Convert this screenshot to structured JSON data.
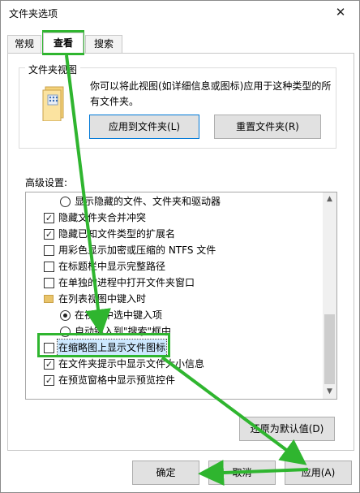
{
  "window": {
    "title": "文件夹选项",
    "close_glyph": "✕"
  },
  "tabs": [
    {
      "label": "常规"
    },
    {
      "label": "查看"
    },
    {
      "label": "搜索"
    }
  ],
  "folder_views": {
    "group_title": "文件夹视图",
    "description": "你可以将此视图(如详细信息或图标)应用于这种类型的所有文件夹。",
    "apply_button": "应用到文件夹(L)",
    "reset_button": "重置文件夹(R)"
  },
  "advanced": {
    "label": "高级设置:",
    "items": [
      {
        "kind": "radio",
        "checked": false,
        "indent": 1,
        "label": "显示隐藏的文件、文件夹和驱动器"
      },
      {
        "kind": "checkbox",
        "checked": true,
        "indent": 0,
        "label": "隐藏文件夹合并冲突"
      },
      {
        "kind": "checkbox",
        "checked": true,
        "indent": 0,
        "label": "隐藏已知文件类型的扩展名"
      },
      {
        "kind": "checkbox",
        "checked": false,
        "indent": 0,
        "label": "用彩色显示加密或压缩的 NTFS 文件"
      },
      {
        "kind": "checkbox",
        "checked": false,
        "indent": 0,
        "label": "在标题栏中显示完整路径"
      },
      {
        "kind": "checkbox",
        "checked": false,
        "indent": 0,
        "label": "在单独的进程中打开文件夹窗口"
      },
      {
        "kind": "folder",
        "checked": false,
        "indent": 0,
        "label": "在列表视图中键入时"
      },
      {
        "kind": "radio",
        "checked": true,
        "indent": 1,
        "label": "在视图中选中键入项"
      },
      {
        "kind": "radio",
        "checked": false,
        "indent": 1,
        "label": "自动键入到\"搜索\"框中"
      },
      {
        "kind": "checkbox",
        "checked": false,
        "indent": 0,
        "label": "在缩略图上显示文件图标",
        "selected": true
      },
      {
        "kind": "checkbox",
        "checked": true,
        "indent": 0,
        "label": "在文件夹提示中显示文件大小信息"
      },
      {
        "kind": "checkbox",
        "checked": true,
        "indent": 0,
        "label": "在预览窗格中显示预览控件"
      }
    ]
  },
  "buttons": {
    "restore": "还原为默认值(D)",
    "ok": "确定",
    "cancel": "取消",
    "apply": "应用(A)"
  },
  "scroll_glyphs": {
    "up": "▲",
    "down": "▼"
  },
  "annotation_color": "#2fb52f"
}
